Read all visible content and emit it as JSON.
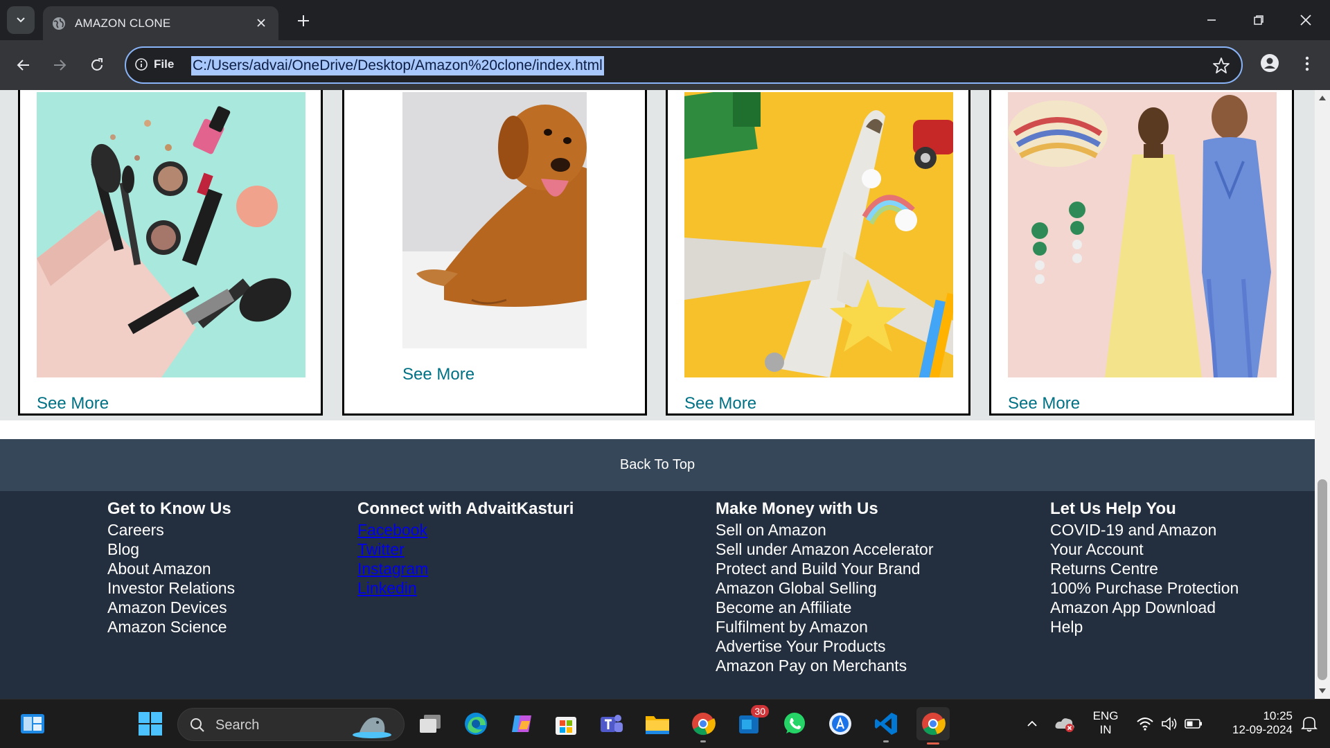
{
  "browser": {
    "tab_title": "AMAZON CLONE",
    "omnibox_label": "File",
    "url": "C:/Users/advai/OneDrive/Desktop/Amazon%20clone/index.html"
  },
  "boxes": [
    {
      "image": "makeup-products-image",
      "link": "See More"
    },
    {
      "image": "golden-retriever-image",
      "link": "See More"
    },
    {
      "image": "toy-airplane-image",
      "link": "See More"
    },
    {
      "image": "fashion-models-image",
      "link": "See More"
    }
  ],
  "back_to_top": "Back To Top",
  "footer": {
    "col1": {
      "title": "Get to Know Us",
      "items": [
        "Careers",
        "Blog",
        "About Amazon",
        "Investor Relations",
        "Amazon Devices",
        "Amazon Science"
      ]
    },
    "col2": {
      "title": "Connect with AdvaitKasturi",
      "items": [
        "Facebook",
        "Twitter",
        "Instagram",
        "Linkedin"
      ]
    },
    "col3": {
      "title": "Make Money with Us",
      "items": [
        "Sell on Amazon",
        "Sell under Amazon Accelerator",
        "Protect and Build Your Brand",
        "Amazon Global Selling",
        "Become an Affiliate",
        "Fulfilment by Amazon",
        "Advertise Your Products",
        "Amazon Pay on Merchants"
      ]
    },
    "col4": {
      "title": "Let Us Help You",
      "items": [
        "COVID-19 and Amazon",
        "Your Account",
        "Returns Centre",
        "100% Purchase Protection",
        "Amazon App Download",
        "Help"
      ]
    }
  },
  "taskbar": {
    "search_placeholder": "Search",
    "store_badge": "30",
    "lang_top": "ENG",
    "lang_bottom": "IN",
    "time": "10:25",
    "date": "12-09-2024"
  }
}
